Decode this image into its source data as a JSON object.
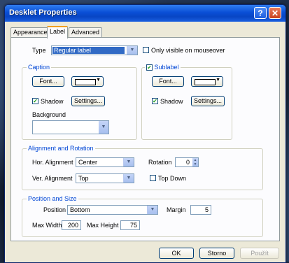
{
  "window": {
    "title": "Desklet Properties"
  },
  "title_buttons": {
    "help": "?",
    "close": "✕"
  },
  "tabs": [
    {
      "label": "Appearance"
    },
    {
      "label": "Label"
    },
    {
      "label": "Advanced"
    }
  ],
  "type_row": {
    "label": "Type",
    "value": "Regular label",
    "only_visible_label": "Only visible on mouseover"
  },
  "caption": {
    "group_label": "Caption",
    "font_button": "Font...",
    "shadow_label": "Shadow",
    "shadow_checked": true,
    "settings_button": "Settings...",
    "background_label": "Background"
  },
  "sublabel": {
    "group_label": "Sublabel",
    "checked": true,
    "font_button": "Font...",
    "shadow_label": "Shadow",
    "shadow_checked": true,
    "settings_button": "Settings..."
  },
  "alignment": {
    "group_label": "Alignment and Rotation",
    "hor_label": "Hor. Alignment",
    "hor_value": "Center",
    "ver_label": "Ver. Alignment",
    "ver_value": "Top",
    "rotation_label": "Rotation",
    "rotation_value": "0",
    "top_down_label": "Top Down"
  },
  "position": {
    "group_label": "Position and Size",
    "position_label": "Position",
    "position_value": "Bottom",
    "margin_label": "Margin",
    "margin_value": "5",
    "max_width_label": "Max Width",
    "max_width_value": "200",
    "max_height_label": "Max Height",
    "max_height_value": "75"
  },
  "footer": {
    "ok": "OK",
    "cancel": "Storno",
    "apply": "Použít"
  },
  "colors": {
    "titlebar": "#0a4fd6",
    "dialog_bg": "#ece9d8",
    "group_label": "#0046d5",
    "selection": "#316ac5"
  }
}
